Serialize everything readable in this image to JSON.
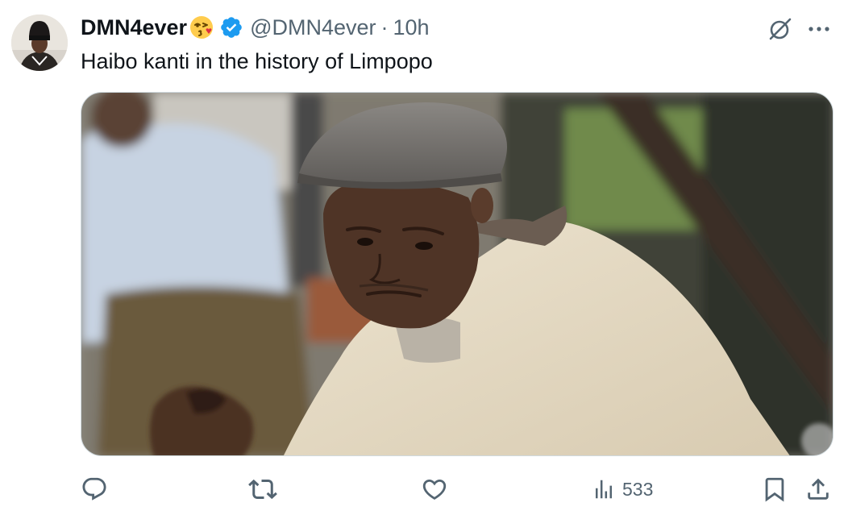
{
  "tweet": {
    "author": {
      "display_name": "DMN4ever",
      "emoji": "kissing-face-icon",
      "verified": true,
      "handle": "@DMN4ever",
      "separator": "·",
      "time": "10h"
    },
    "text": "Haibo kanti in the history of Limpopo",
    "media": {
      "description_icon": "photo-image"
    },
    "actions": {
      "reply": {
        "icon": "reply-icon"
      },
      "retweet": {
        "icon": "retweet-icon"
      },
      "like": {
        "icon": "heart-icon"
      },
      "views": {
        "icon": "bar-chart-icon",
        "count": "533"
      },
      "bookmark": {
        "icon": "bookmark-icon"
      },
      "share": {
        "icon": "share-icon"
      }
    },
    "top_right": {
      "grok": {
        "icon": "grok-icon"
      },
      "more": {
        "icon": "more-icon"
      }
    }
  },
  "colors": {
    "text_primary": "#0f1419",
    "text_secondary": "#536471",
    "verified_blue": "#1d9bf0"
  }
}
